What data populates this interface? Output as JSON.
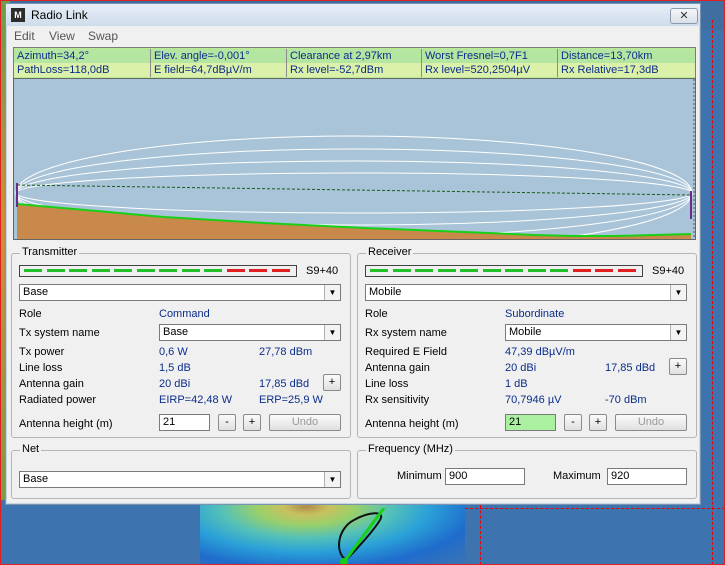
{
  "window": {
    "title": "Radio Link",
    "close_symbol": "✕"
  },
  "menu": [
    "Edit",
    "View",
    "Swap"
  ],
  "info": {
    "azimuth": "Azimuth=34,2°",
    "elev": "Elev. angle=-0,001°",
    "clearance": "Clearance at 2,97km",
    "fresnel": "Worst Fresnel=0,7F1",
    "distance": "Distance=13,70km",
    "pathloss": "PathLoss=118,0dB",
    "efield": "E field=64,7dBµV/m",
    "rx_dbm": "Rx level=-52,7dBm",
    "rx_uv": "Rx level=520,2504µV",
    "rx_rel": "Rx Relative=17,3dB"
  },
  "transmitter": {
    "title": "Transmitter",
    "meter_label": "S9+40",
    "unit": "Base",
    "role_label": "Role",
    "role_value": "Command",
    "system_label": "Tx system name",
    "system_value": "Base",
    "power_label": "Tx power",
    "power_w": "0,6 W",
    "power_dbm": "27,78 dBm",
    "lineloss_label": "Line loss",
    "lineloss_value": "1,5 dB",
    "gain_label": "Antenna gain",
    "gain_dbi": "20 dBi",
    "gain_dbd": "17,85 dBd",
    "radiated_label": "Radiated power",
    "eirp": "EIRP=42,48 W",
    "erp": "ERP=25,9 W",
    "height_label": "Antenna height (m)",
    "height_value": "21",
    "minus": "-",
    "plus": "+",
    "undo": "Undo"
  },
  "receiver": {
    "title": "Receiver",
    "meter_label": "S9+40",
    "unit": "Mobile",
    "role_label": "Role",
    "role_value": "Subordinate",
    "system_label": "Rx system name",
    "system_value": "Mobile",
    "efield_label": "Required E Field",
    "efield_value": "47,39 dBµV/m",
    "gain_label": "Antenna gain",
    "gain_dbi": "20 dBi",
    "gain_dbd": "17,85 dBd",
    "lineloss_label": "Line loss",
    "lineloss_value": "1 dB",
    "sens_label": "Rx sensitivity",
    "sens_uv": "70,7946 µV",
    "sens_dbm": "-70 dBm",
    "height_label": "Antenna height (m)",
    "height_value": "21",
    "minus": "-",
    "plus": "+",
    "undo": "Undo"
  },
  "net": {
    "title": "Net",
    "value": "Base"
  },
  "frequency": {
    "title": "Frequency (MHz)",
    "min_label": "Minimum",
    "min_value": "900",
    "max_label": "Maximum",
    "max_value": "920"
  },
  "colors": {
    "meter_green": "#22c02a",
    "meter_red": "#e02020",
    "terrain": "#c8894a",
    "ground_line": "#18d018"
  }
}
